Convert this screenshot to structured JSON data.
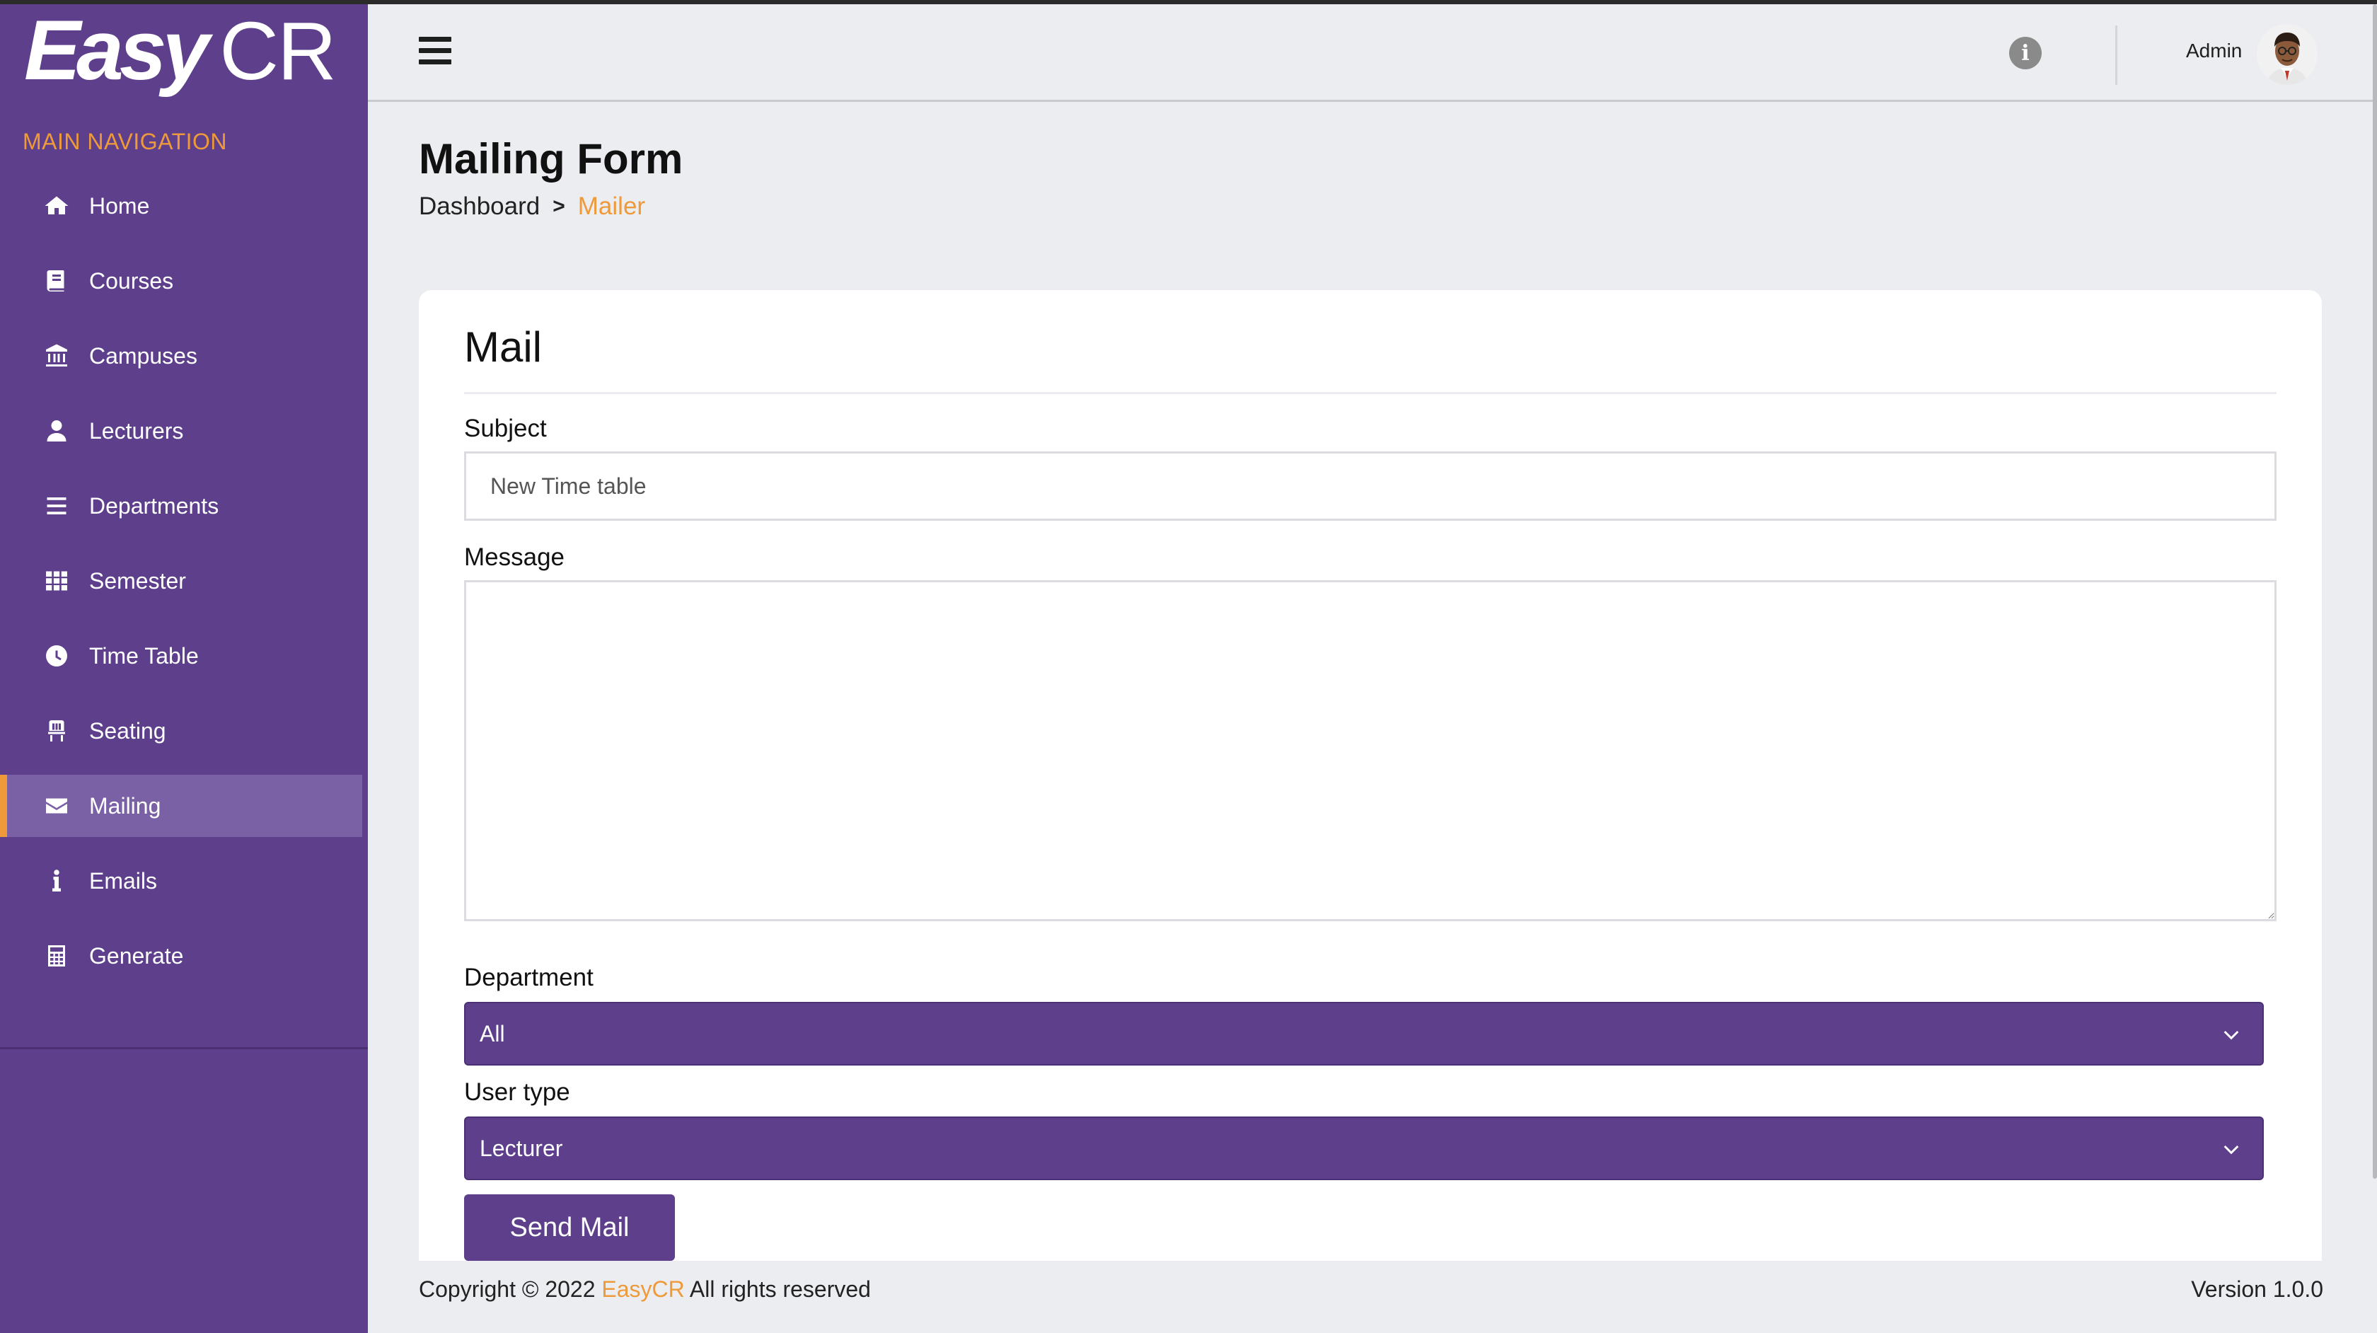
{
  "brand": {
    "logo_easy": "Easy",
    "logo_cr": "CR"
  },
  "sidebar": {
    "heading": "MAIN NAVIGATION",
    "items": [
      {
        "label": "Home",
        "icon": "home-icon"
      },
      {
        "label": "Courses",
        "icon": "book-icon"
      },
      {
        "label": "Campuses",
        "icon": "institution-icon"
      },
      {
        "label": "Lecturers",
        "icon": "user-icon"
      },
      {
        "label": "Departments",
        "icon": "list-icon"
      },
      {
        "label": "Semester",
        "icon": "grid-icon"
      },
      {
        "label": "Time Table",
        "icon": "clock-icon"
      },
      {
        "label": "Seating",
        "icon": "chair-icon"
      },
      {
        "label": "Mailing",
        "icon": "envelope-icon",
        "active": true
      },
      {
        "label": "Emails",
        "icon": "info-icon"
      },
      {
        "label": "Generate",
        "icon": "calculator-icon"
      }
    ],
    "accent_color": "#ee9a3a",
    "background_color": "#5e3f8c"
  },
  "header": {
    "user_name": "Admin",
    "info_glyph": "i"
  },
  "page": {
    "title": "Mailing Form",
    "breadcrumb": {
      "root": "Dashboard",
      "separator": ">",
      "current": "Mailer"
    }
  },
  "form": {
    "card_title": "Mail",
    "subject_label": "Subject",
    "subject_placeholder": "New Time table",
    "message_label": "Message",
    "message_value": "",
    "department_label": "Department",
    "department_selected": "All",
    "user_type_label": "User type",
    "user_type_selected": "Lecturer",
    "submit_label": "Send Mail"
  },
  "footer": {
    "copyright_prefix": "Copyright © 2022",
    "brand": "EasyCR",
    "copyright_suffix": "All rights reserved",
    "version": "Version 1.0.0"
  }
}
